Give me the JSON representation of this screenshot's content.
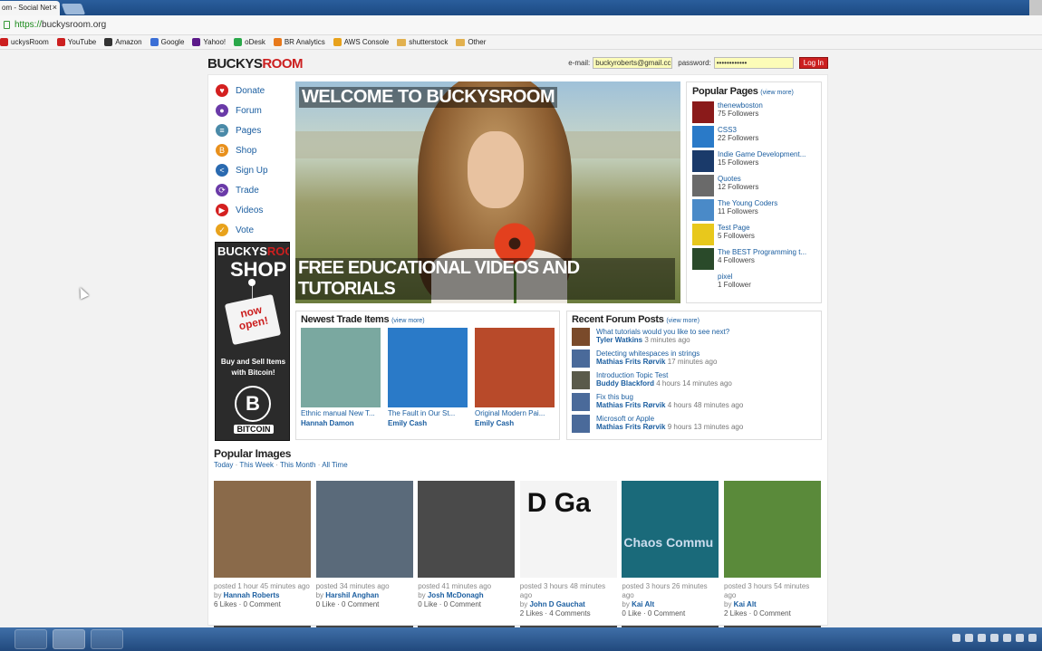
{
  "browser": {
    "tab_title": "om - Social Net",
    "tab_close": "×",
    "url_scheme": "https://",
    "url_host": "buckysroom.org",
    "bookmarks": [
      {
        "label": "uckysRoom",
        "icon": "buckysroom-icon",
        "color": "#cc1f1f"
      },
      {
        "label": "YouTube",
        "icon": "youtube-icon",
        "color": "#cc1f1f"
      },
      {
        "label": "Amazon",
        "icon": "amazon-icon",
        "color": "#333333"
      },
      {
        "label": "Google",
        "icon": "google-icon",
        "color": "#3b6fd6"
      },
      {
        "label": "Yahoo!",
        "icon": "yahoo-icon",
        "color": "#5c1a8a"
      },
      {
        "label": "oDesk",
        "icon": "odesk-icon",
        "color": "#2aa84a"
      },
      {
        "label": "BR Analytics",
        "icon": "analytics-icon",
        "color": "#e87a1c"
      },
      {
        "label": "AWS Console",
        "icon": "aws-icon",
        "color": "#e8a21c"
      },
      {
        "label": "shutterstock",
        "icon": "folder-icon",
        "color": "#e2b14f"
      },
      {
        "label": "Other",
        "icon": "folder-icon",
        "color": "#e2b14f"
      }
    ]
  },
  "header": {
    "logo_part1": "BUCKYS",
    "logo_part2": "ROOM",
    "email_label": "e-mail:",
    "email_value": "buckyroberts@gmail.cc",
    "password_label": "password:",
    "password_value": "••••••••••••",
    "login_button": "Log In"
  },
  "nav": [
    {
      "label": "Donate",
      "icon": "heart-icon",
      "color": "#d42020",
      "glyph": "♥"
    },
    {
      "label": "Forum",
      "icon": "chat-bubbles-icon",
      "color": "#6a3aa8",
      "glyph": "●"
    },
    {
      "label": "Pages",
      "icon": "pages-stack-icon",
      "color": "#4a8aa8",
      "glyph": "≡"
    },
    {
      "label": "Shop",
      "icon": "bitcoin-icon",
      "color": "#e8901c",
      "glyph": "B"
    },
    {
      "label": "Sign Up",
      "icon": "share-icon",
      "color": "#2a6ab0",
      "glyph": "<"
    },
    {
      "label": "Trade",
      "icon": "swap-icon",
      "color": "#6a3aa8",
      "glyph": "⟳"
    },
    {
      "label": "Videos",
      "icon": "play-icon",
      "color": "#d42020",
      "glyph": "▶"
    },
    {
      "label": "Vote",
      "icon": "checkmark-icon",
      "color": "#e8a21c",
      "glyph": "✓"
    }
  ],
  "shop_banner": {
    "line1a": "BUCKYS",
    "line1b": "ROOM",
    "line2": "SHOP",
    "sign": "now open!",
    "tagline": "Buy and Sell Items with Bitcoin!",
    "coin_glyph": "B",
    "coin_label": "BITCOIN"
  },
  "hero": {
    "caption_top": "WELCOME TO BUCKYSROOM",
    "caption_bottom": "FREE EDUCATIONAL VIDEOS AND TUTORIALS"
  },
  "popular_pages": {
    "title": "Popular Pages",
    "view_more": "(view more)",
    "items": [
      {
        "name": "thenewboston",
        "followers": "75 Followers",
        "color": "#8a1a1a"
      },
      {
        "name": "CSS3",
        "followers": "22 Followers",
        "color": "#2a7ac8"
      },
      {
        "name": "Indie Game Development...",
        "followers": "15 Followers",
        "color": "#1a3a6a"
      },
      {
        "name": "Quotes",
        "followers": "12 Followers",
        "color": "#6a6a6a"
      },
      {
        "name": "The Young Coders",
        "followers": "11 Followers",
        "color": "#4a8ac8"
      },
      {
        "name": "Test Page",
        "followers": "5 Followers",
        "color": "#e8c81c"
      },
      {
        "name": "The BEST Programming t...",
        "followers": "4 Followers",
        "color": "#2a4a2a"
      },
      {
        "name": "pixel",
        "followers": "1 Follower",
        "color": "#ffffff"
      }
    ]
  },
  "trade": {
    "title": "Newest Trade Items",
    "view_more": "(view more)",
    "items": [
      {
        "name": "Ethnic manual New T...",
        "user": "Hannah Damon",
        "color": "#7aa8a0"
      },
      {
        "name": "The Fault in Our St...",
        "user": "Emily Cash",
        "color": "#2a7ac8"
      },
      {
        "name": "Original Modern Pai...",
        "user": "Emily Cash",
        "color": "#b84a2a"
      }
    ]
  },
  "forum": {
    "title": "Recent Forum Posts",
    "view_more": "(view more)",
    "items": [
      {
        "title": "What tutorials would you like to see next?",
        "user": "Tyler Watkins",
        "time": "3 minutes ago",
        "color": "#7a4a2a"
      },
      {
        "title": "Detecting whitespaces in strings",
        "user": "Mathias Frits Rørvik",
        "time": "17 minutes ago",
        "color": "#4a6a9a"
      },
      {
        "title": "Introduction Topic Test",
        "user": "Buddy Blackford",
        "time": "4 hours 14 minutes ago",
        "color": "#5a5a4a"
      },
      {
        "title": "Fix this bug",
        "user": "Mathias Frits Rørvik",
        "time": "4 hours 48 minutes ago",
        "color": "#4a6a9a"
      },
      {
        "title": "Microsoft or Apple",
        "user": "Mathias Frits Rørvik",
        "time": "9 hours 13 minutes ago",
        "color": "#4a6a9a"
      }
    ]
  },
  "popular_images": {
    "title": "Popular Images",
    "filters": [
      "Today",
      "This Week",
      "This Month",
      "All Time"
    ],
    "separator": " · ",
    "by_label": "by ",
    "items": [
      {
        "posted": "posted 1 hour 45 minutes ago",
        "user": "Hannah Roberts",
        "stats": "6 Likes · 0 Comment",
        "color": "#8a6a4a"
      },
      {
        "posted": "posted 34 minutes ago",
        "user": "Harshil Anghan",
        "stats": "0 Like · 0 Comment",
        "color": "#5a6a7a"
      },
      {
        "posted": "posted 41 minutes ago",
        "user": "Josh McDonagh",
        "stats": "0 Like · 0 Comment",
        "color": "#4a4a4a"
      },
      {
        "posted": "posted 3 hours 48 minutes ago",
        "user": "John D Gauchat",
        "stats": "2 Likes · 4 Comments",
        "color": "#f4f4f4",
        "text": "D Ga"
      },
      {
        "posted": "posted 3 hours 26 minutes ago",
        "user": "Kai Alt",
        "stats": "0 Like · 0 Comment",
        "color": "#1a6a7a",
        "text": "Chaos Commu"
      },
      {
        "posted": "posted 3 hours 54 minutes ago",
        "user": "Kai Alt",
        "stats": "2 Likes · 0 Comment",
        "color": "#5a8a3a"
      }
    ]
  }
}
